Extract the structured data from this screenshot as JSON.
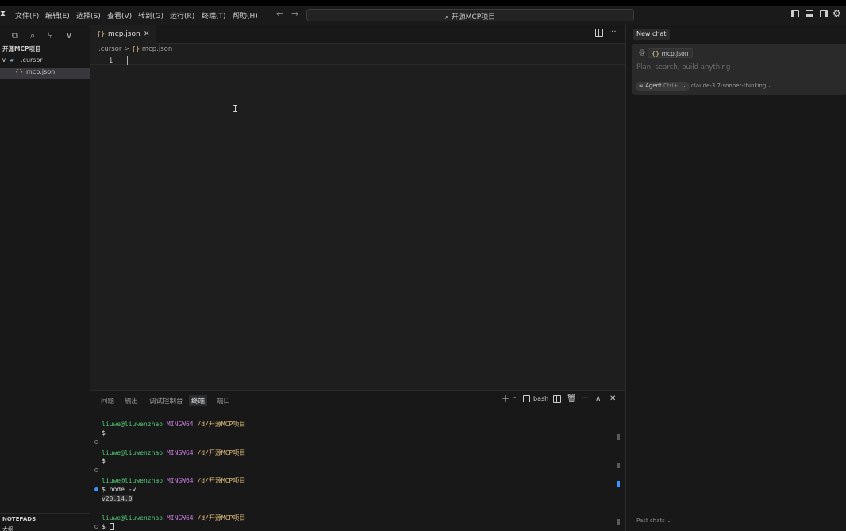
{
  "menu": {
    "logo": "⧗",
    "items": [
      "文件(F)",
      "编辑(E)",
      "选择(S)",
      "查看(V)",
      "转到(G)",
      "运行(R)",
      "终端(T)",
      "帮助(H)"
    ],
    "back_arrow": "←",
    "forward_arrow": "→"
  },
  "search": {
    "icon": "⌕",
    "text": "开源MCP项目"
  },
  "explorer": {
    "project_title": "开源MCP项目",
    "folder": ".cursor",
    "file": "mcp.json",
    "chevron": "∨",
    "file_glyph": "{}",
    "notepads_label": "NOTEPADS",
    "notepads_sub": "大纲"
  },
  "editor": {
    "tab_label": "mcp.json",
    "tab_close": "✕",
    "breadcrumb_folder": ".cursor",
    "breadcrumb_sep": ">",
    "breadcrumb_file": "mcp.json",
    "line_number": "1",
    "ibeam": "I",
    "more": "···"
  },
  "panel": {
    "tabs": [
      "问题",
      "输出",
      "调试控制台",
      "终端",
      "端口"
    ],
    "active_tab_index": 3,
    "actions": {
      "add": "+",
      "dropdown": "⌄",
      "shell": "bash",
      "more": "···",
      "maximize": "∧",
      "close": "✕"
    },
    "terminal": {
      "user": "liuwe@liuwenzhao",
      "host": "MINGW64",
      "path": "/d/开源MCP项目",
      "prompt": "$",
      "command": "node -v",
      "output": "v20.14.0"
    }
  },
  "chat": {
    "tab_label": "New chat",
    "at_symbol": "@",
    "context_file": "mcp.json",
    "placeholder": "Plan, search, build anything",
    "agent_label": "Agent",
    "agent_shortcut": "Ctrl+I",
    "model": "claude-3.7-sonnet-thinking",
    "past_chats": "Past chats",
    "chevron": "⌄"
  },
  "colors": {
    "terminal_user": "#50c878",
    "terminal_host": "#c678dd",
    "terminal_path": "#e5c07b",
    "json_icon": "#e2c08d",
    "accent_blue": "#3794ff"
  }
}
